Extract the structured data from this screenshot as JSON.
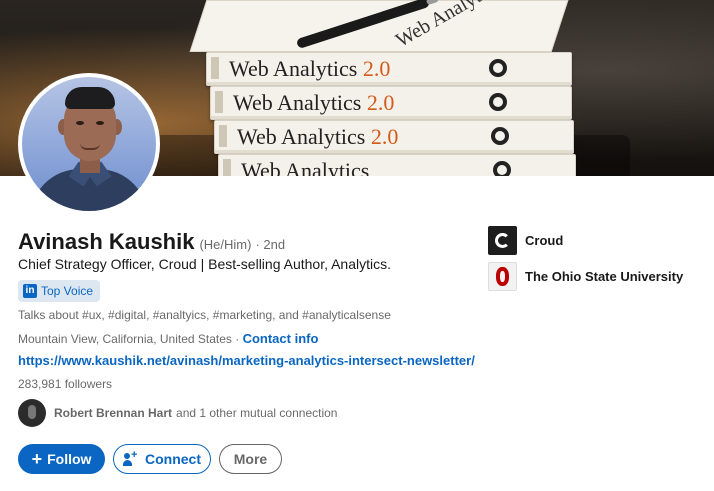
{
  "cover": {
    "book_title": "Web Analytics",
    "book_version": "2.0",
    "book_top_title": "Web Analytics"
  },
  "profile": {
    "name": "Avinash Kaushik",
    "pronouns": "(He/Him)",
    "degree": "· 2nd",
    "headline": "Chief Strategy Officer, Croud | Best-selling Author, Analytics.",
    "badge": "Top Voice",
    "badge_icon_text": "in",
    "talks_about": "Talks about #ux, #digital, #analtyics, #marketing, and #analyticalsense",
    "location": "Mountain View, California, United States",
    "location_separator": " · ",
    "contact_info": "Contact info",
    "website": "https://www.kaushik.net/avinash/marketing-analytics-intersect-newsletter/",
    "followers": "283,981 followers",
    "mutual_name": "Robert Brennan Hart",
    "mutual_rest": "and 1 other mutual connection"
  },
  "actions": {
    "follow_icon": "+",
    "follow_label": "Follow",
    "connect_label": "Connect",
    "more_label": "More"
  },
  "orgs": [
    {
      "name": "Croud",
      "logo": "croud-logo"
    },
    {
      "name": "The Ohio State University",
      "logo": "ohio-state-logo"
    }
  ],
  "colors": {
    "accent": "#0a66c2",
    "badge_bg": "#dde7f1",
    "osu_red": "#bb0000"
  }
}
